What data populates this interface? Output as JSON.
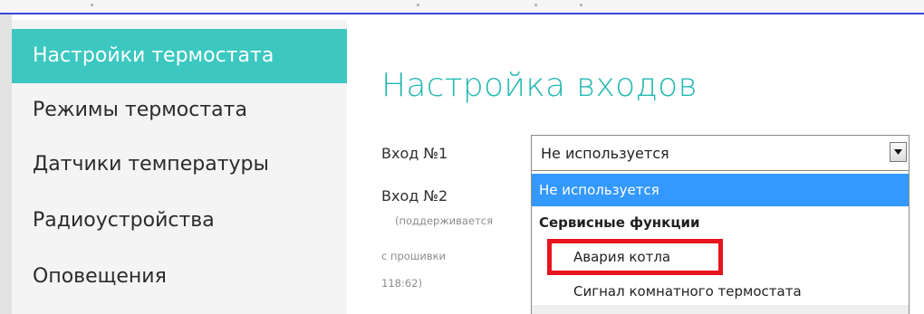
{
  "sidebar": {
    "items": [
      {
        "label": "Настройки термостата",
        "active": true
      },
      {
        "label": "Режимы термостата",
        "active": false
      },
      {
        "label": "Датчики температуры",
        "active": false
      },
      {
        "label": "Радиоустройства",
        "active": false
      },
      {
        "label": "Оповещения",
        "active": false
      }
    ]
  },
  "main": {
    "title": "Настройка входов",
    "input1": {
      "label": "Вход №1",
      "value": "Не используется"
    },
    "input2": {
      "label": "Вход №2",
      "note_lines": [
        "(поддерживается",
        "с прошивки",
        "118:62)"
      ]
    },
    "dropdown": {
      "options": [
        {
          "label": "Не используется",
          "kind": "selected"
        },
        {
          "label": "Сервисные функции",
          "kind": "group"
        },
        {
          "label": "Авария котла",
          "kind": "option",
          "highlighted": true
        },
        {
          "label": "Сигнал комнатного термостата",
          "kind": "option"
        }
      ]
    }
  },
  "colors": {
    "accent": "#3cc8c0",
    "title": "#25b8b3",
    "selection": "#3399ff",
    "highlight_border": "#e8141e",
    "window_border": "#3b46d6"
  },
  "icons": {
    "dropdown_arrow": "chevron-down-icon"
  }
}
